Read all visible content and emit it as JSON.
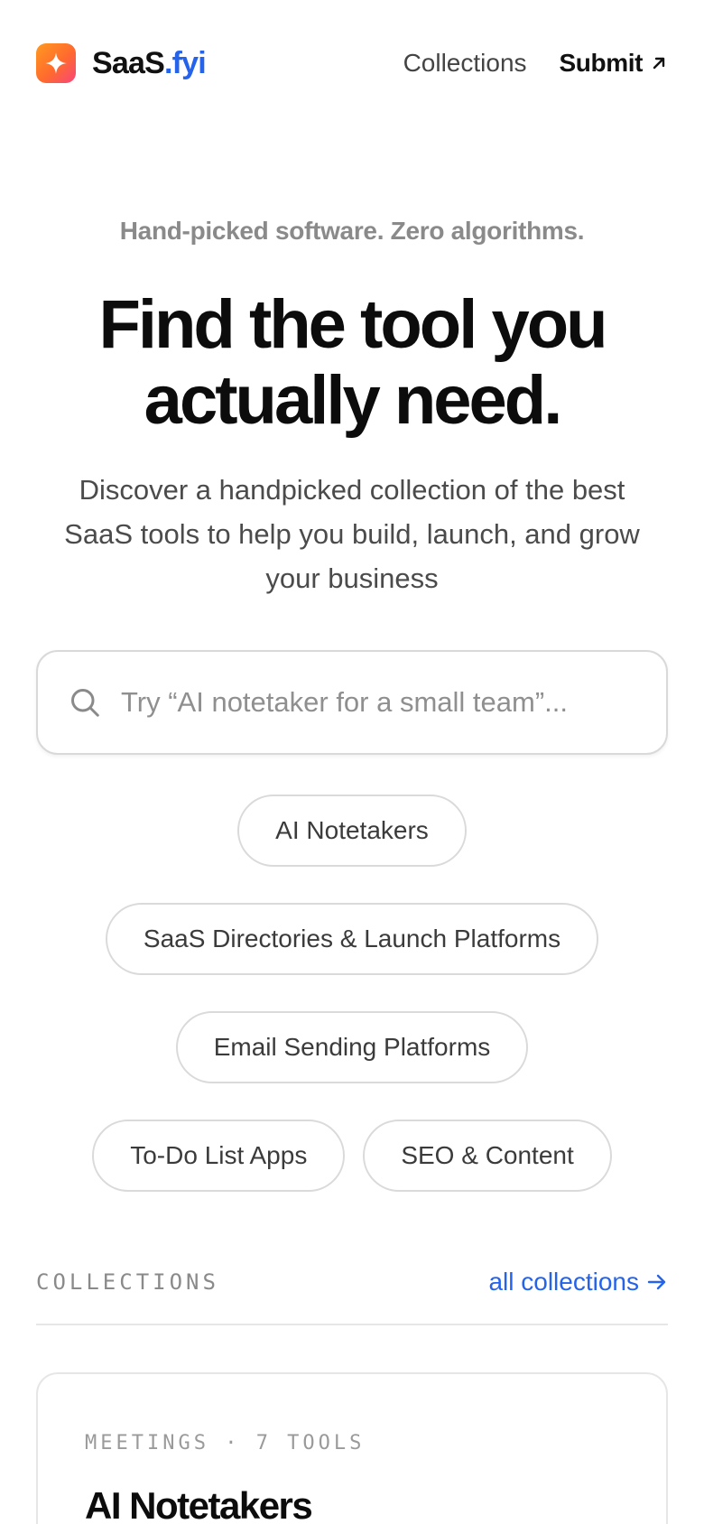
{
  "header": {
    "brand": {
      "name": "SaaS",
      "tld": ".fyi"
    },
    "nav": {
      "collections": "Collections",
      "submit": "Submit"
    }
  },
  "hero": {
    "eyebrow": "Hand-picked software. Zero algorithms.",
    "headline_line1": "Find the tool you",
    "headline_line2": "actually need.",
    "subhead": "Discover a handpicked collection of the best SaaS tools to help you build, launch, and grow your business"
  },
  "search": {
    "placeholder": "Try “AI notetaker for a small team”...",
    "value": ""
  },
  "chips": [
    "AI Notetakers",
    "SaaS Directories & Launch Platforms",
    "Email Sending Platforms",
    "To-Do List Apps",
    "SEO & Content"
  ],
  "collections": {
    "label": "COLLECTIONS",
    "link": "all collections"
  },
  "card": {
    "meta": "MEETINGS · 7 TOOLS",
    "title": "AI Notetakers"
  },
  "colors": {
    "accent": "#2563eb",
    "logo_gradient": [
      "#ff9a1f",
      "#f8457a"
    ]
  },
  "icons": {
    "logo": "sparkle-icon",
    "submit": "arrow-up-right-icon",
    "search": "search-icon",
    "collections_link": "arrow-right-icon"
  }
}
